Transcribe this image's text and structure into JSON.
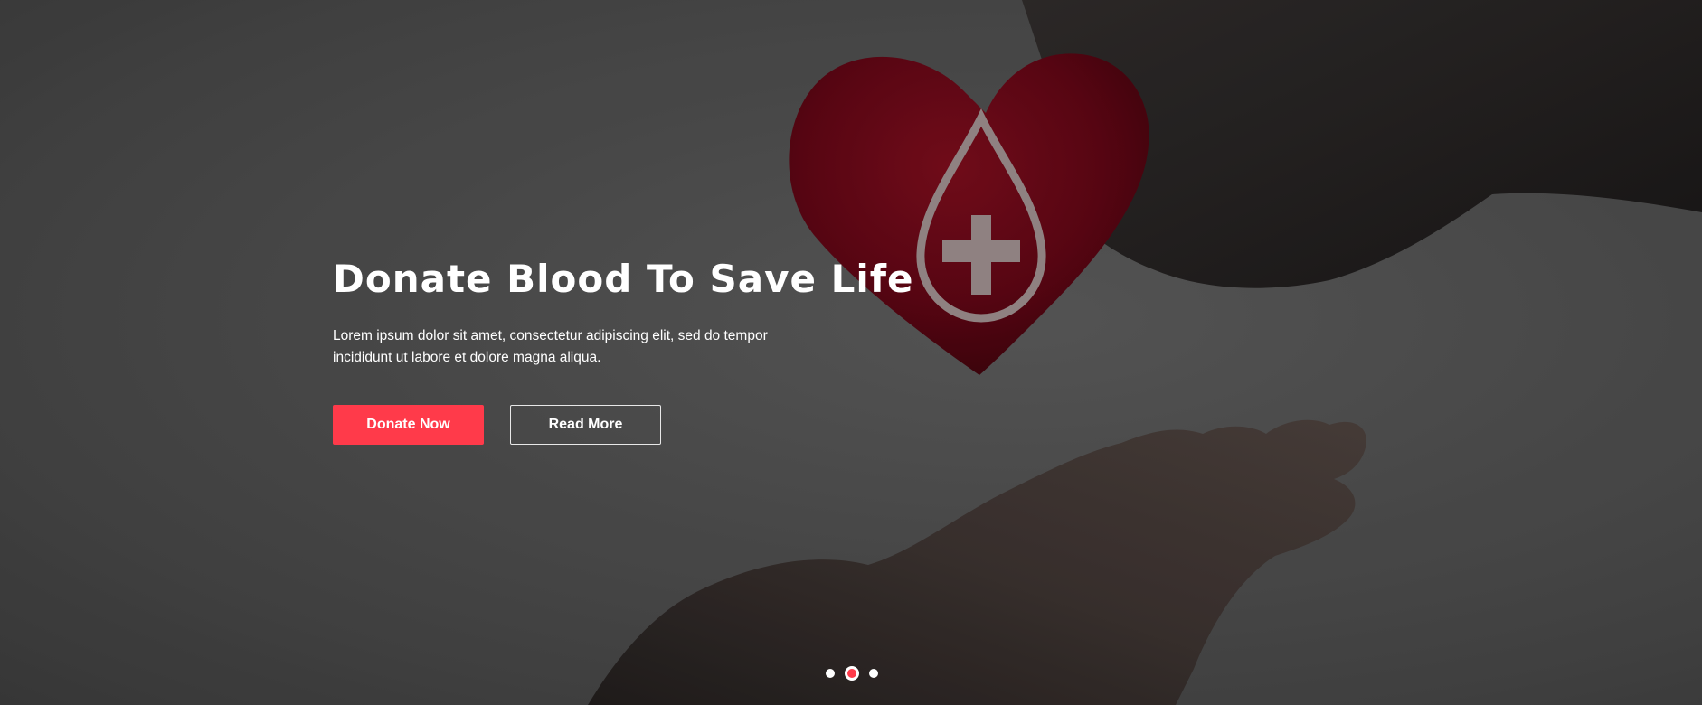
{
  "hero": {
    "title": "Donate Blood To Save Life",
    "description": "Lorem ipsum dolor sit amet, consectetur adipiscing elit, sed do tempor incididunt ut labore et dolore magna aliqua.",
    "primary_button": "Donate Now",
    "secondary_button": "Read More",
    "background_image": "hands-holding-heart-with-blood-drop-icon"
  },
  "carousel": {
    "slide_count": 3,
    "active_index": 1
  },
  "colors": {
    "accent": "#ff3a4a",
    "text": "#ffffff",
    "background": "#4a4a4a",
    "heart": "#6e0a18"
  }
}
